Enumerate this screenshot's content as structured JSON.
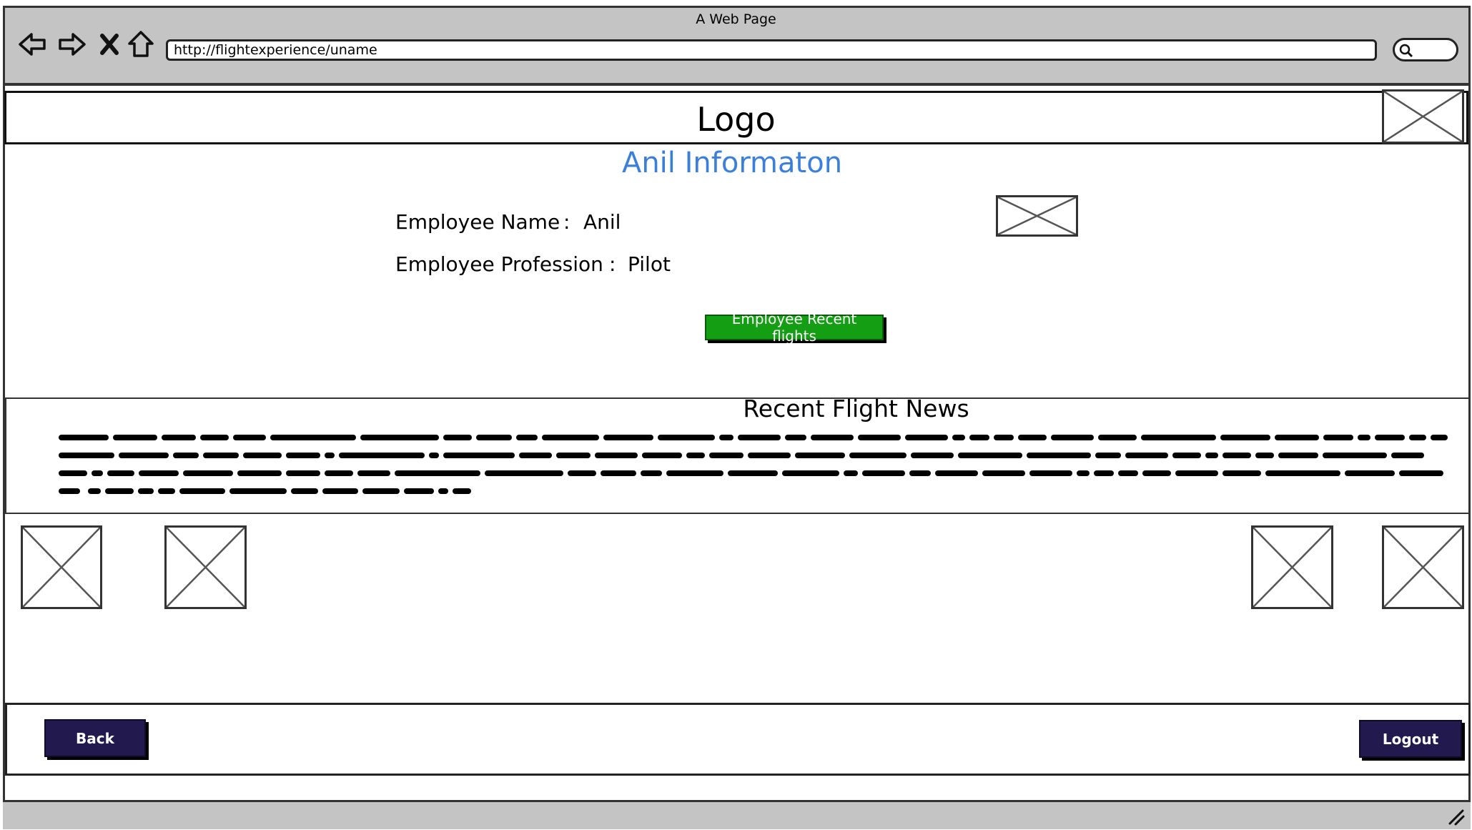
{
  "browser": {
    "window_title": "A Web Page",
    "url": "http://flightexperience/uname",
    "nav_icons": [
      "back-arrow-icon",
      "forward-arrow-icon",
      "stop-icon",
      "home-icon"
    ],
    "search_icon": "search-icon"
  },
  "header": {
    "logo_text": "Logo"
  },
  "employee": {
    "title": "Anil Informaton",
    "name_label": "Employee Name",
    "name_value": "Anil",
    "profession_label": "Employee Profession",
    "profession_value": "Pilot",
    "separator": ":",
    "recent_flights_button": "Employee Recent flights"
  },
  "news": {
    "title": "Recent Flight News"
  },
  "footer": {
    "back_label": "Back",
    "logout_label": "Logout"
  },
  "colors": {
    "chrome": "#c4c4c4",
    "title_blue": "#3a7fdc",
    "button_green": "#139e13",
    "button_dark": "#221a4e"
  }
}
